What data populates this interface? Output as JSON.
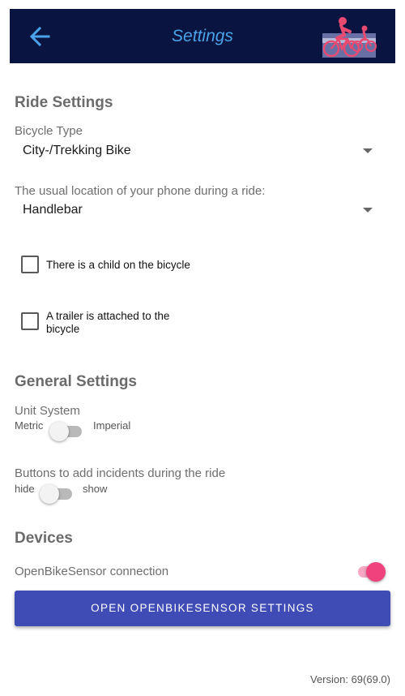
{
  "appbar": {
    "title": "Settings",
    "back_icon": "arrow-left-icon",
    "logo_icon": "cyclists-logo-icon"
  },
  "ride_settings": {
    "title": "Ride Settings",
    "bicycle_type": {
      "label": "Bicycle Type",
      "value": "City-/Trekking Bike"
    },
    "phone_location": {
      "label": "The usual location of your phone during a ride:",
      "value": "Handlebar"
    },
    "child_checkbox": {
      "label": "There is a child on the bicycle",
      "checked": false
    },
    "trailer_checkbox": {
      "label": "A trailer is attached to the bicycle",
      "checked": false
    }
  },
  "general_settings": {
    "title": "General Settings",
    "unit_system": {
      "label": "Unit System",
      "off_label": "Metric",
      "on_label": "Imperial",
      "enabled": false
    },
    "incident_buttons": {
      "label": "Buttons to add incidents during the ride",
      "off_label": "hide",
      "on_label": "show",
      "enabled": false
    }
  },
  "devices": {
    "title": "Devices",
    "obs_connection": {
      "label": "OpenBikeSensor connection",
      "enabled": true
    },
    "open_settings_button": "OPEN OPENBIKESENSOR SETTINGS"
  },
  "footer": {
    "version": "Version: 69(69.0)"
  },
  "colors": {
    "appbar": "#0a1440",
    "title": "#4aa3e8",
    "accent": "#f0437e",
    "button": "#3f4cb6"
  }
}
